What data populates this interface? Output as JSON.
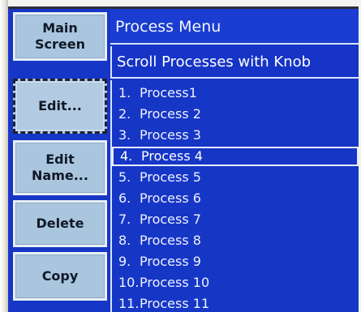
{
  "sidebar": {
    "buttons": [
      {
        "label": "Main\nScreen",
        "selected": false
      },
      {
        "label": "Edit...",
        "selected": true
      },
      {
        "label": "Edit\nName...",
        "selected": false
      },
      {
        "label": "Delete",
        "selected": false
      },
      {
        "label": "Copy",
        "selected": false
      }
    ]
  },
  "header": {
    "title": "Process Menu",
    "instruction": "Scroll Processes with Knob"
  },
  "process_list": {
    "selected_index": 3,
    "items": [
      {
        "num": "1.",
        "name": "Process1"
      },
      {
        "num": "2.",
        "name": "Process 2"
      },
      {
        "num": "3.",
        "name": "Process 3"
      },
      {
        "num": "4.",
        "name": "Process 4"
      },
      {
        "num": "5.",
        "name": "Process 5"
      },
      {
        "num": "6.",
        "name": "Process 6"
      },
      {
        "num": "7.",
        "name": "Process 7"
      },
      {
        "num": "8.",
        "name": "Process 8"
      },
      {
        "num": "9.",
        "name": "Process 9"
      },
      {
        "num": "10.",
        "name": "Process 10"
      },
      {
        "num": "11.",
        "name": "Process 11"
      }
    ]
  },
  "colors": {
    "screen_bg": "#1636c6",
    "button_bg": "#aac6df",
    "text_light": "#eef2ff"
  }
}
